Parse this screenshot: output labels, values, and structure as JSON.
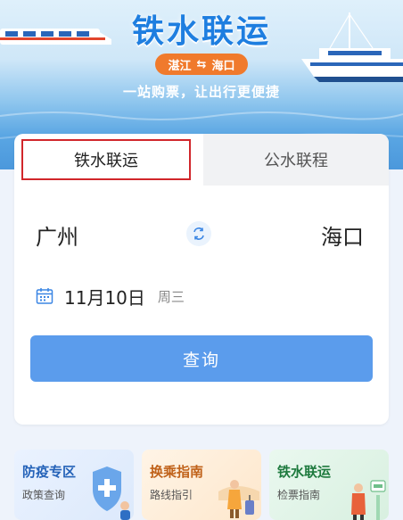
{
  "banner": {
    "title": "铁水联运",
    "route_from": "湛江",
    "route_swap": "⇆",
    "route_to": "海口",
    "slogan": "一站购票，让出行更便捷"
  },
  "tabs": [
    {
      "label": "铁水联运",
      "active": true
    },
    {
      "label": "公水联程",
      "active": false
    }
  ],
  "search": {
    "from_city": "广州",
    "to_city": "海口",
    "date": "11月10日",
    "weekday": "周三",
    "query_label": "查询"
  },
  "tiles": [
    {
      "title": "防疫专区",
      "subtitle": "政策查询"
    },
    {
      "title": "换乘指南",
      "subtitle": "路线指引"
    },
    {
      "title": "铁水联运",
      "subtitle": "检票指南"
    }
  ],
  "colors": {
    "brand_blue": "#1e7ee0",
    "route_pill": "#f07a2c",
    "query_button": "#5b9cec",
    "active_tab_border": "#d1262b"
  }
}
